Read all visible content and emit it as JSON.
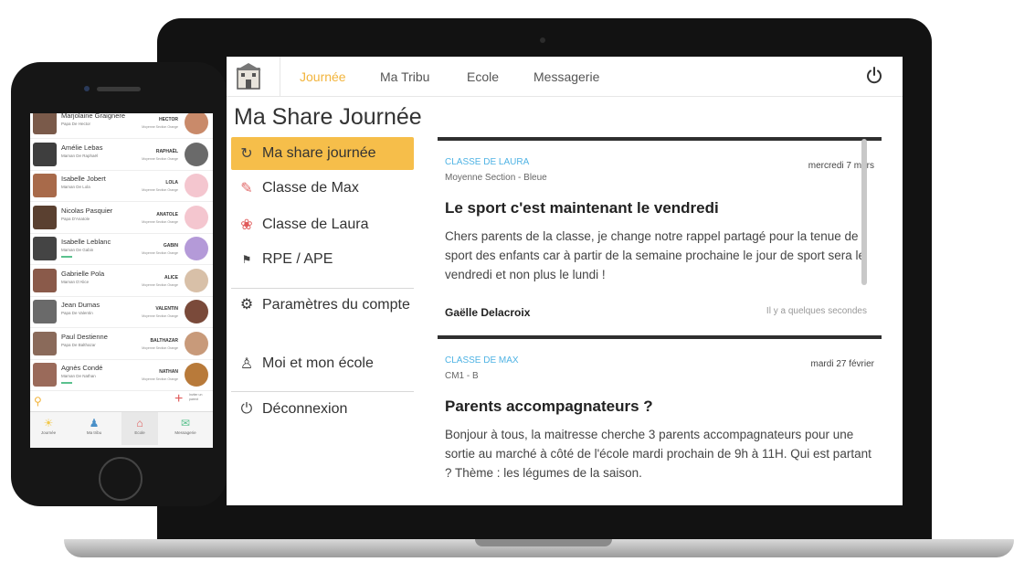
{
  "laptop": {
    "nav": {
      "tabs": [
        "Journée",
        "Ma Tribu",
        "Ecole",
        "Messagerie"
      ],
      "active_tab": "Journée"
    },
    "page_title": "Ma Share Journée",
    "sidebar": {
      "items": [
        {
          "label": "Ma share journée",
          "icon": "refresh-icon"
        },
        {
          "label": "Classe de Max",
          "icon": "school-kid-icon"
        },
        {
          "label": "Classe de Laura",
          "icon": "girl-book-icon"
        },
        {
          "label": "RPE / APE",
          "icon": "group-icon"
        }
      ],
      "settings_label": "Paramètres du compte",
      "school_label": "Moi et mon école",
      "logout_label": "Déconnexion"
    },
    "feed": [
      {
        "class_name": "CLASSE DE LAURA",
        "date": "mercredi 7 mars",
        "subtitle": "Moyenne Section - Bleue",
        "title": "Le sport c'est maintenant le vendredi",
        "body": "Chers parents de la classe, je change notre rappel partagé pour la tenue de sport des enfants car à partir de la semaine prochaine le jour de sport sera le vendredi et non plus le lundi !",
        "author": "Gaëlle Delacroix",
        "time": "Il y a quelques secondes"
      },
      {
        "class_name": "CLASSE DE MAX",
        "date": "mardi 27 février",
        "subtitle": "CM1 - B",
        "title": "Parents accompagnateurs ?",
        "body": "Bonjour à tous, la maitresse cherche 3 parents accompagnateurs pour une sortie au marché à côté de l'école mardi prochain de 9h à 11H. Qui est partant ? Thème : les légumes de la saison."
      }
    ]
  },
  "phone": {
    "contacts": [
      {
        "name": "Marjolaine Graignere",
        "relation": "Papa De Hector",
        "child": "HECTOR",
        "child_class": "Moyenne Section Orange",
        "avatar_color": "#7a5a4a",
        "kid_color": "#c98a6a"
      },
      {
        "name": "Amélie Lebas",
        "relation": "Maman De Raphaël",
        "child": "RAPHAËL",
        "child_class": "Moyenne Section Orange",
        "avatar_color": "#3e3e3e",
        "kid_color": "#6a6a6a"
      },
      {
        "name": "Isabelle Jobert",
        "relation": "Maman De Lola",
        "child": "LOLA",
        "child_class": "Moyenne Section Orange",
        "avatar_color": "#a86a4a",
        "kid_color": "#f4c6cf"
      },
      {
        "name": "Nicolas Pasquier",
        "relation": "Papa D'Anatole",
        "child": "ANATOLE",
        "child_class": "Moyenne Section Orange",
        "avatar_color": "#5a4030",
        "kid_color": "#f4c6cf"
      },
      {
        "name": "Isabelle Leblanc",
        "relation": "Maman De Gabin",
        "child": "GABIN",
        "child_class": "Moyenne Section Orange",
        "avatar_color": "#444444",
        "kid_color": "#b49ad8"
      },
      {
        "name": "Gabrielle Pola",
        "relation": "Maman D'Alice",
        "child": "ALICE",
        "child_class": "Moyenne Section Orange",
        "avatar_color": "#8a5a4a",
        "kid_color": "#d8c0a8"
      },
      {
        "name": "Jean Dumas",
        "relation": "Papa De Valentin",
        "child": "VALENTIN",
        "child_class": "Moyenne Section Orange",
        "avatar_color": "#6a6a6a",
        "kid_color": "#7a4a3a"
      },
      {
        "name": "Paul Destienne",
        "relation": "Papa De Balthazar",
        "child": "BALTHAZAR",
        "child_class": "Moyenne Section Orange",
        "avatar_color": "#8a6a5a",
        "kid_color": "#c89a7a"
      },
      {
        "name": "Agnès Condé",
        "relation": "Maman De Nathan",
        "child": "NATHAN",
        "child_class": "Moyenne Section Orange",
        "avatar_color": "#9a6a5a",
        "kid_color": "#b87a3a"
      }
    ],
    "invite_label": "Inviter un parent",
    "tabbar": [
      {
        "label": "Journée",
        "icon": "sun-icon",
        "color": "#f2c94c"
      },
      {
        "label": "Ma tribu",
        "icon": "tribe-icon",
        "color": "#4a90c8"
      },
      {
        "label": "Ecole",
        "icon": "school-icon",
        "color": "#e05a5a"
      },
      {
        "label": "Messagerie",
        "icon": "chat-icon",
        "color": "#5ac18e"
      }
    ]
  }
}
